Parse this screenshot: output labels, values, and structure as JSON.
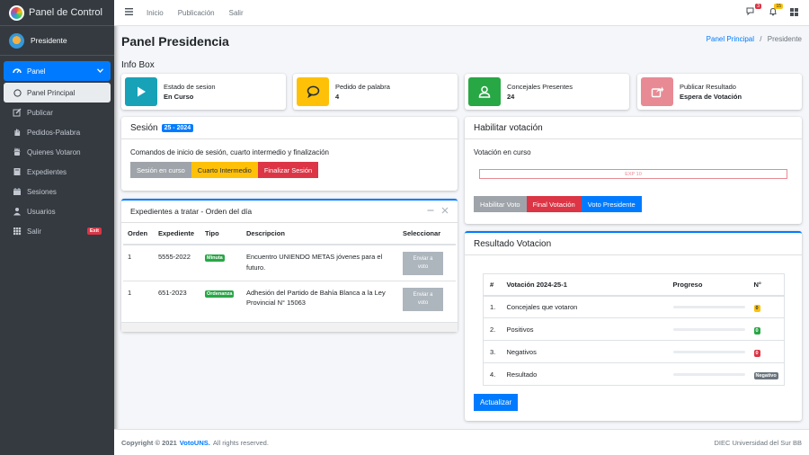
{
  "sidebar": {
    "brand": "Panel de Control",
    "user": "Presidente",
    "items": [
      {
        "label": "Panel",
        "icon": "dashboard-icon"
      },
      {
        "label": "Panel Principal",
        "icon": "circle-icon"
      },
      {
        "label": "Publicar",
        "icon": "edit-icon"
      },
      {
        "label": "Pedidos-Palabra",
        "icon": "hand-icon"
      },
      {
        "label": "Quienes Votaron",
        "icon": "eye-icon"
      },
      {
        "label": "Expedientes",
        "icon": "book-icon"
      },
      {
        "label": "Sesiones",
        "icon": "calendar-icon"
      },
      {
        "label": "Usuarios",
        "icon": "user-icon"
      },
      {
        "label": "Salir",
        "icon": "grid-icon",
        "badge": "Exit"
      }
    ]
  },
  "topbar": {
    "links": [
      "Inicio",
      "Publicación",
      "Salir"
    ],
    "messages_badge": "3",
    "notifications_badge": "15"
  },
  "page": {
    "title": "Panel Presidencia",
    "breadcrumb_home": "Panel Principal",
    "breadcrumb_sep": "/",
    "breadcrumb_current": "Presidente",
    "infobox_title": "Info Box"
  },
  "info_boxes": [
    {
      "label": "Estado de sesion",
      "value": "En Curso",
      "color": "#17a2b8",
      "icon": "play-icon"
    },
    {
      "label": "Pedido de palabra",
      "value": "4",
      "color": "#ffc107",
      "icon": "comment-icon"
    },
    {
      "label": "Concejales Presentes",
      "value": "24",
      "color": "#28a745",
      "icon": "user-icon"
    },
    {
      "label": "Publicar Resultado",
      "value": "Espera de Votación",
      "color": "#e88a94",
      "icon": "share-icon"
    }
  ],
  "session": {
    "title": "Sesión",
    "badge": "25 - 2024",
    "description": "Comandos de inicio de sesión, cuarto intermedio y finalización",
    "btn_start": "Sesión en curso",
    "btn_break": "Cuarto Intermedio",
    "btn_end": "Finalizar Sesión"
  },
  "voting": {
    "title": "Habilitar votación",
    "subtitle": "Votación en curso",
    "exp_label": "EXP 10",
    "btn_enable": "Habilitar Voto",
    "btn_end": "Final Votación",
    "btn_president": "Voto Presidente"
  },
  "expedientes": {
    "title": "Expedientes a tratar - Orden del día",
    "headers": [
      "Orden",
      "Expediente",
      "Tipo",
      "Descripcion",
      "Seleccionar"
    ],
    "send_label_1": "Enviar a",
    "send_label_2": "voto",
    "rows": [
      {
        "orden": "1",
        "expediente": "5555-2022",
        "tipo": "Minuta",
        "desc1": "Encuentro UNIENDO METAS jóvenes para el",
        "desc2": "futuro."
      },
      {
        "orden": "1",
        "expediente": "651-2023",
        "tipo": "Ordenanza",
        "desc1": "Adhesión del Partido de Bahía Blanca a la Ley",
        "desc2": "Provincial N° 15063"
      }
    ]
  },
  "results": {
    "title": "Resultado Votacion",
    "headers": [
      "#",
      "Votación 2024-25-1",
      "Progreso",
      "N°"
    ],
    "rows": [
      {
        "n": "1.",
        "label": "Concejales que votaron",
        "value": "0",
        "color": "#ffc107",
        "progress": 0
      },
      {
        "n": "2.",
        "label": "Positivos",
        "value": "0",
        "color": "#28a745",
        "progress": 0
      },
      {
        "n": "3.",
        "label": "Negativos",
        "value": "0",
        "color": "#dc3545",
        "progress": 0
      },
      {
        "n": "4.",
        "label": "Resultado",
        "value": "Negativo",
        "color": "#6c757d",
        "progress": 0
      }
    ],
    "btn_update": "Actualizar"
  },
  "footer": {
    "copyright": "Copyright © 2021",
    "brand": "VotoUNS.",
    "rights": "All rights reserved.",
    "right_text": "DIEC Universidad del Sur BB"
  }
}
